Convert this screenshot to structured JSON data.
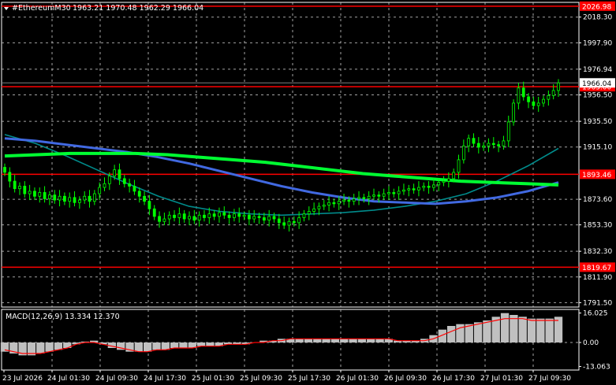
{
  "header": {
    "symbol_timeframe": "#EthereumM30",
    "ohlc": "1963.21 1970.48 1962.29 1966.04"
  },
  "price_axis": {
    "ticks": [
      "2018.30",
      "1997.90",
      "1976.94",
      "1956.50",
      "1935.50",
      "1915.10",
      "1873.60",
      "1853.30",
      "1832.30",
      "1811.90",
      "1791.50"
    ],
    "ylim": [
      1788,
      2030
    ]
  },
  "levels": [
    {
      "label": "2026.98",
      "value": 2026.98,
      "color": "#ff0000"
    },
    {
      "label": "1963.00",
      "value": 1963.0,
      "color": "#ff0000"
    },
    {
      "label": "1893.46",
      "value": 1893.46,
      "color": "#ff0000"
    },
    {
      "label": "1819.67",
      "value": 1819.67,
      "color": "#ff0000"
    }
  ],
  "current_price": {
    "label": "1966.04",
    "value": 1966.04
  },
  "macd": {
    "title": "MACD(12,26,9) 13.334 12.370",
    "ticks": [
      "16.025",
      "0.00",
      "-13.063"
    ],
    "ylim": [
      -15,
      18
    ]
  },
  "time_axis": {
    "labels": [
      "23 Jul 2026",
      "24 Jul 01:30",
      "24 Jul 09:30",
      "24 Jul 17:30",
      "25 Jul 01:30",
      "25 Jul 09:30",
      "25 Jul 17:30",
      "26 Jul 01:30",
      "26 Jul 09:30",
      "26 Jul 17:30",
      "27 Jul 01:30",
      "27 Jul 09:30"
    ]
  },
  "colors": {
    "background": "#000000",
    "grid": "#c0c0c0",
    "candle": "#00ff00",
    "ma_fast": "#00ff32",
    "ma_mid": "#4169e1",
    "ma_slow": "#008b8b",
    "level": "#ff0000",
    "macd_hist": "#c0c0c0",
    "macd_signal": "#ff0000"
  },
  "chart_data": {
    "type": "candlestick",
    "price_ylim": [
      1788,
      2030
    ],
    "closes": [
      1895,
      1888,
      1882,
      1884,
      1878,
      1880,
      1876,
      1879,
      1874,
      1877,
      1873,
      1876,
      1872,
      1875,
      1871,
      1873,
      1876,
      1872,
      1878,
      1883,
      1886,
      1892,
      1897,
      1890,
      1886,
      1884,
      1880,
      1876,
      1872,
      1866,
      1860,
      1856,
      1858,
      1861,
      1859,
      1862,
      1858,
      1860,
      1857,
      1861,
      1859,
      1862,
      1860,
      1863,
      1861,
      1859,
      1862,
      1860,
      1861,
      1858,
      1860,
      1859,
      1857,
      1860,
      1858,
      1855,
      1853,
      1856,
      1855,
      1859,
      1862,
      1864,
      1866,
      1868,
      1869,
      1871,
      1870,
      1872,
      1873,
      1872,
      1874,
      1875,
      1874,
      1876,
      1877,
      1876,
      1878,
      1879,
      1878,
      1880,
      1881,
      1882,
      1881,
      1883,
      1884,
      1883,
      1885,
      1887,
      1888,
      1890,
      1895,
      1905,
      1916,
      1922,
      1918,
      1915,
      1916,
      1918,
      1917,
      1916,
      1920,
      1935,
      1950,
      1962,
      1955,
      1951,
      1948,
      1950,
      1953,
      1956,
      1960,
      1966
    ],
    "ma_fast": [
      1908,
      1909,
      1910,
      1910,
      1910,
      1909,
      1907,
      1905,
      1903,
      1900,
      1897,
      1894,
      1892,
      1890,
      1888,
      1887,
      1886,
      1885
    ],
    "ma_mid": [
      1922,
      1920,
      1917,
      1914,
      1911,
      1907,
      1902,
      1896,
      1890,
      1884,
      1879,
      1875,
      1872,
      1871,
      1870,
      1872,
      1875,
      1880,
      1887
    ],
    "ma_slow": [
      1925,
      1918,
      1908,
      1897,
      1886,
      1876,
      1868,
      1864,
      1862,
      1861,
      1862,
      1863,
      1865,
      1868,
      1872,
      1878,
      1888,
      1900,
      1914
    ],
    "macd_hist": [
      -5,
      -6,
      -7,
      -7,
      -6,
      -5,
      -4,
      -3,
      -1,
      0.5,
      1,
      -1,
      -3,
      -4,
      -5,
      -5,
      -5,
      -4,
      -4,
      -3,
      -3,
      -3,
      -2,
      -2,
      -2,
      -1,
      -1,
      -1,
      0,
      1,
      1,
      2,
      2,
      2,
      2,
      2,
      2,
      2,
      2,
      2,
      2,
      2,
      2,
      2,
      1,
      1,
      1,
      2,
      4,
      7,
      9,
      10,
      10,
      11,
      12,
      14,
      16,
      15,
      14,
      13,
      13,
      13,
      14
    ],
    "macd_signal": [
      -4,
      -5,
      -6,
      -6,
      -6,
      -5,
      -4,
      -3,
      -1,
      0,
      0,
      -1,
      -2,
      -3,
      -4,
      -5,
      -5,
      -4,
      -4,
      -3,
      -3,
      -3,
      -2,
      -2,
      -2,
      -1,
      -1,
      -1,
      0,
      0,
      1,
      1,
      2,
      2,
      2,
      2,
      2,
      2,
      2,
      2,
      2,
      2,
      2,
      2,
      1,
      1,
      1,
      1,
      2,
      4,
      6,
      8,
      9,
      10,
      11,
      12,
      13,
      13,
      13,
      12,
      12,
      12,
      12
    ]
  }
}
